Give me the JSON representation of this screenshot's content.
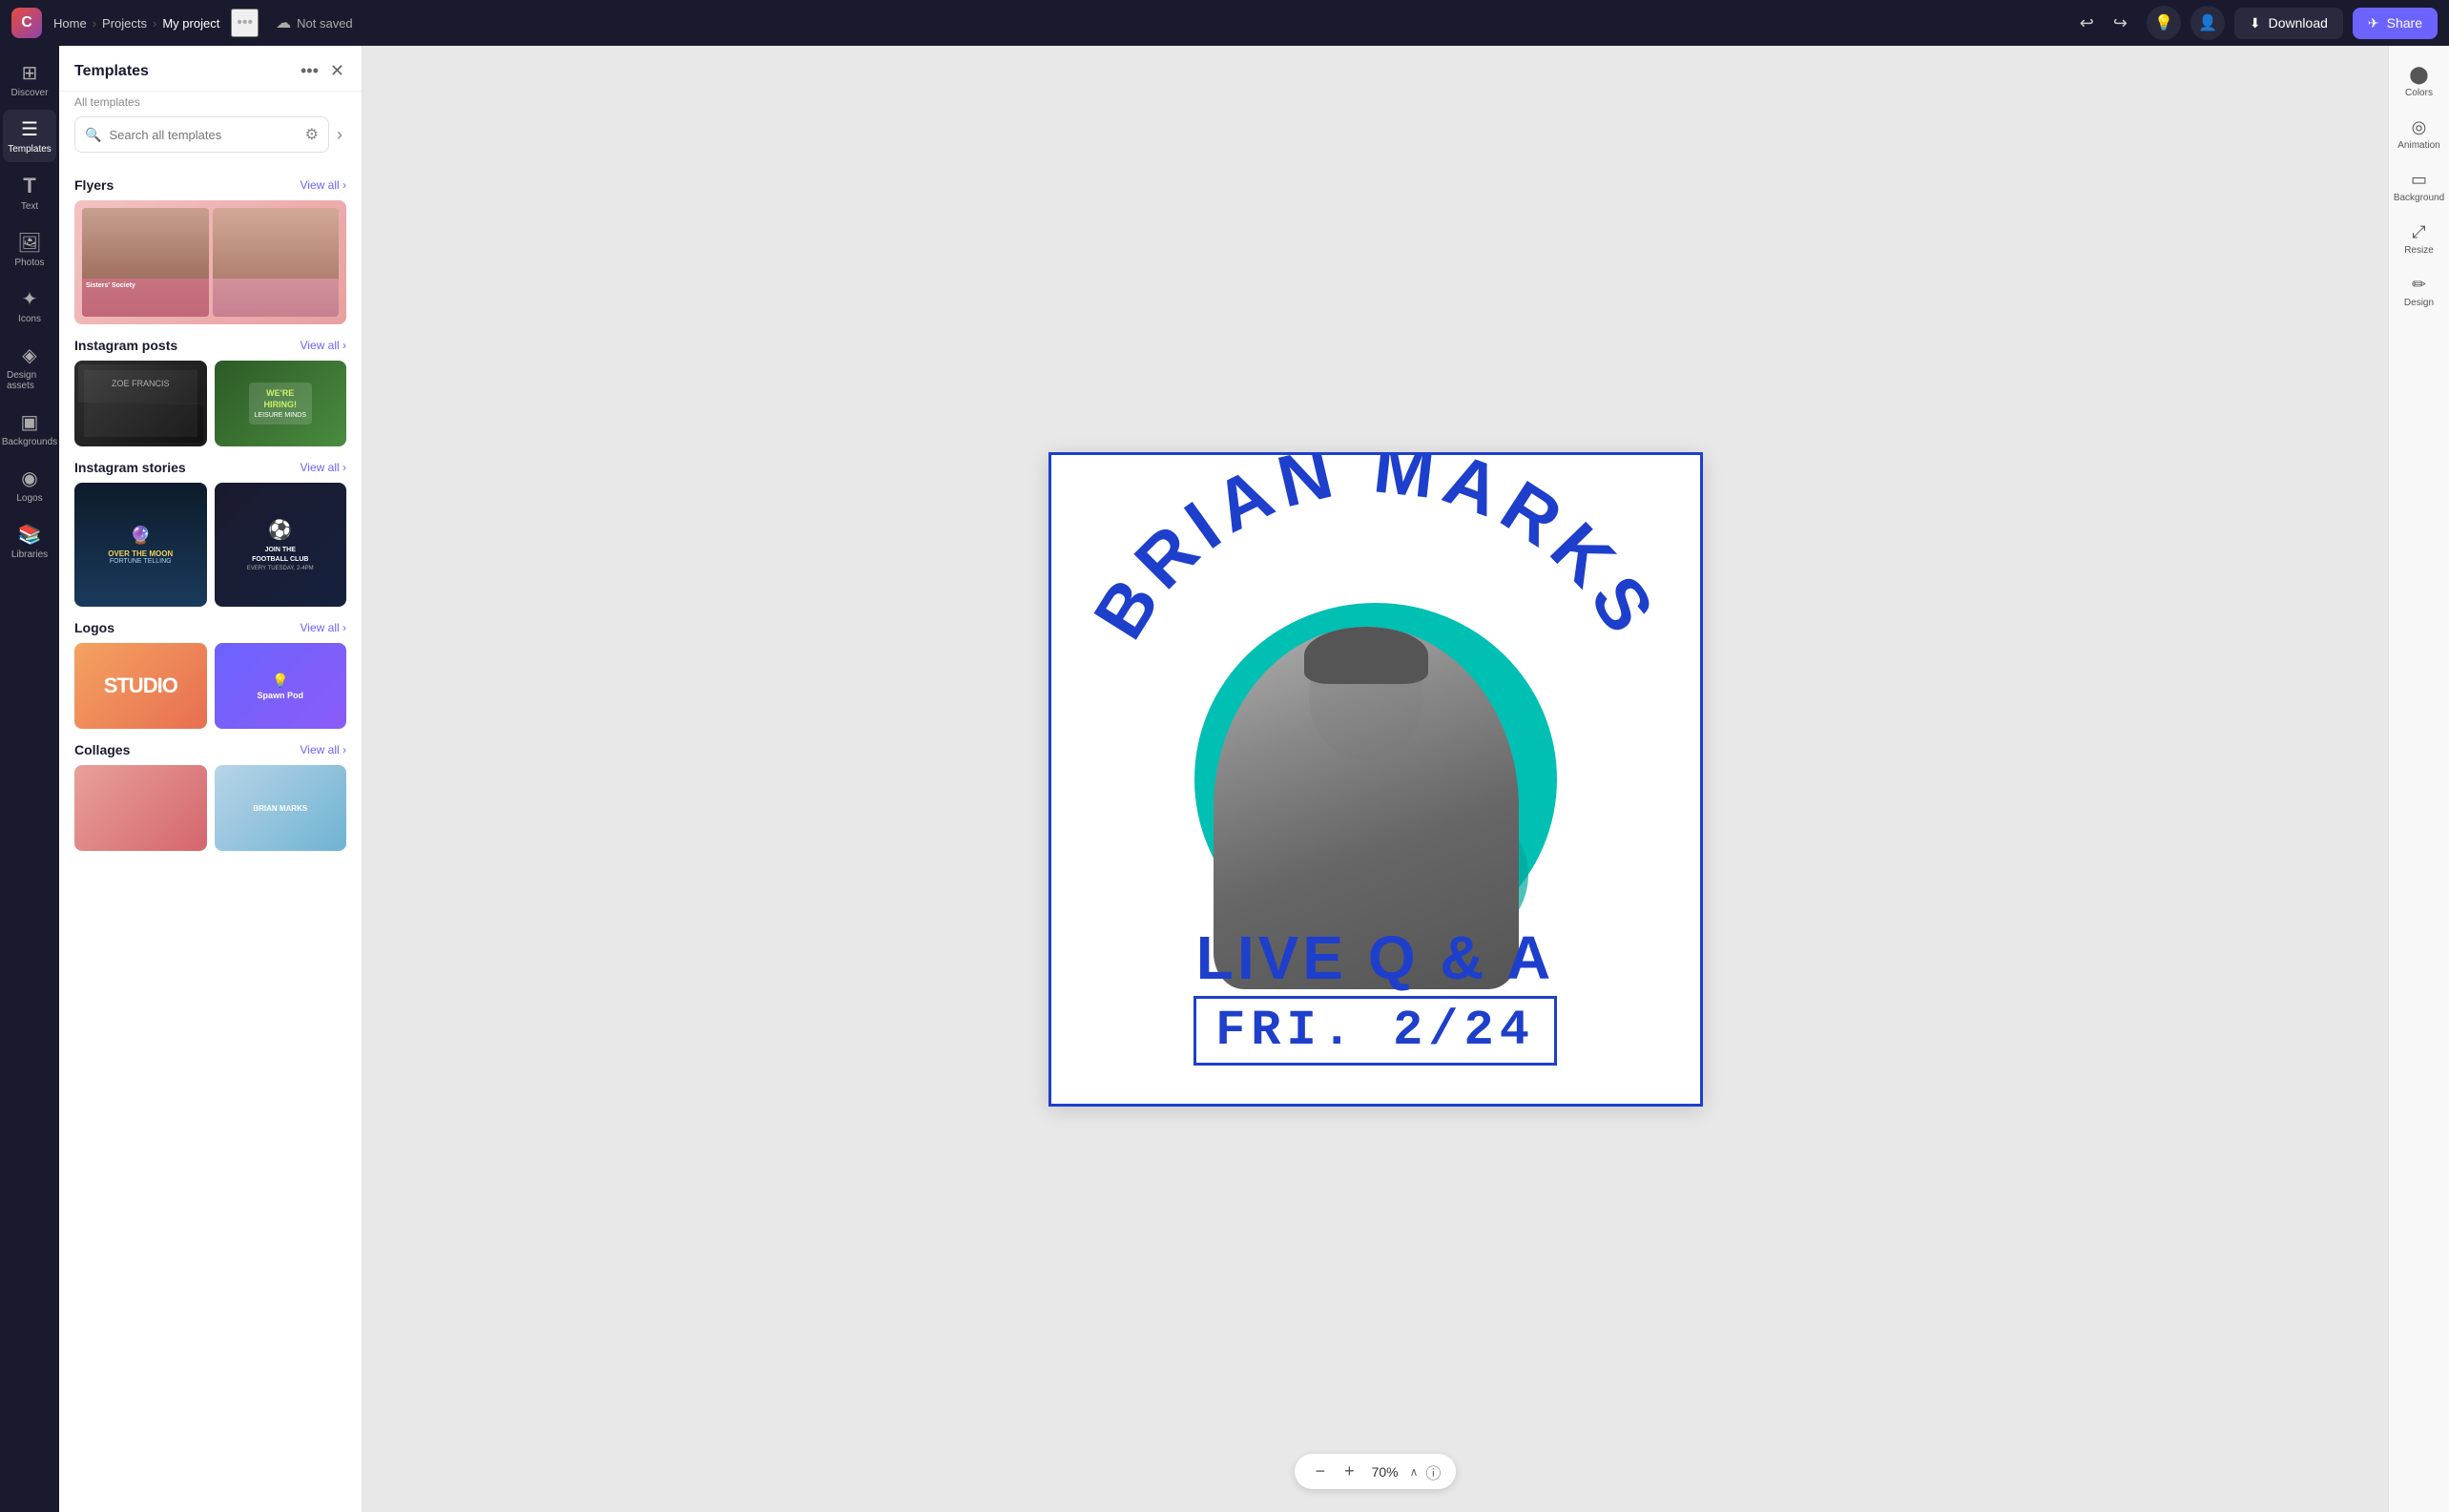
{
  "app": {
    "logo_text": "C",
    "nav": {
      "home": "Home",
      "projects": "Projects",
      "current": "My project",
      "more_icon": "•••",
      "save_status": "Not saved"
    },
    "undo_icon": "↩",
    "redo_icon": "↪",
    "toolbar": {
      "download_label": "Download",
      "share_label": "Share"
    }
  },
  "sidebar": {
    "items": [
      {
        "id": "discover",
        "label": "Discover",
        "icon": "⊞"
      },
      {
        "id": "templates",
        "label": "Templates",
        "icon": "⊟"
      },
      {
        "id": "text",
        "label": "Text",
        "icon": "T"
      },
      {
        "id": "photos",
        "label": "Photos",
        "icon": "🖼"
      },
      {
        "id": "icons",
        "label": "Icons",
        "icon": "✦"
      },
      {
        "id": "design-assets",
        "label": "Design assets",
        "icon": "◈"
      },
      {
        "id": "backgrounds",
        "label": "Backgrounds",
        "icon": "▣"
      },
      {
        "id": "logos",
        "label": "Logos",
        "icon": "◉"
      },
      {
        "id": "libraries",
        "label": "Libraries",
        "icon": "📚"
      }
    ]
  },
  "templates_panel": {
    "title": "Templates",
    "subtitle": "All templates",
    "search_placeholder": "Search all templates",
    "sections": [
      {
        "id": "flyers",
        "title": "Flyers",
        "view_all": "View all"
      },
      {
        "id": "instagram-posts",
        "title": "Instagram posts",
        "view_all": "View all"
      },
      {
        "id": "instagram-stories",
        "title": "Instagram stories",
        "view_all": "View all"
      },
      {
        "id": "logos",
        "title": "Logos",
        "view_all": "View all"
      },
      {
        "id": "collages",
        "title": "Collages",
        "view_all": "View all"
      }
    ]
  },
  "canvas": {
    "design_title": "Brian Marks Live Q&A",
    "arch_text": "BRIAN MARKS",
    "live_qa": "LIVE Q & A",
    "date": "FRI. 2/24"
  },
  "zoom": {
    "value": "70%",
    "decrease_icon": "−",
    "increase_icon": "+",
    "chevron_icon": "∧",
    "info_icon": "ⓘ"
  },
  "right_sidebar": {
    "items": [
      {
        "id": "colors",
        "label": "Colors",
        "icon": "⬤"
      },
      {
        "id": "animation",
        "label": "Animation",
        "icon": "◎"
      },
      {
        "id": "background",
        "label": "Background",
        "icon": "▭"
      },
      {
        "id": "resize",
        "label": "Resize",
        "icon": "⤢"
      },
      {
        "id": "design",
        "label": "Design",
        "icon": "✏"
      }
    ]
  }
}
